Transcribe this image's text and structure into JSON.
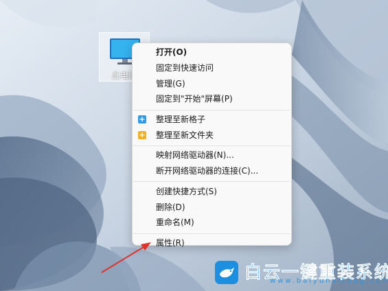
{
  "desktop": {
    "icon_label": "此电脑"
  },
  "context_menu": {
    "groups": [
      [
        {
          "label": "打开(O)",
          "bold": true
        },
        {
          "label": "固定到快速访问"
        },
        {
          "label": "管理(G)"
        },
        {
          "label": "固定到\"开始\"屏幕(P)"
        }
      ],
      [
        {
          "label": "整理至新格子",
          "icon": "plus-square-icon",
          "icon_color": "#2f9be6"
        },
        {
          "label": "整理至新文件夹",
          "icon": "folder-plus-icon",
          "icon_color": "#f0b023"
        }
      ],
      [
        {
          "label": "映射网络驱动器(N)..."
        },
        {
          "label": "断开网络驱动器的连接(C)..."
        }
      ],
      [
        {
          "label": "创建快捷方式(S)"
        },
        {
          "label": "删除(D)"
        },
        {
          "label": "重命名(M)"
        }
      ],
      [
        {
          "label": "属性(R)"
        }
      ]
    ]
  },
  "annotation": {
    "color": "#e0312b",
    "target": "属性(R)"
  },
  "watermark": {
    "title": "白云一键重装系统",
    "url": "www.baiyunxitong.com"
  }
}
